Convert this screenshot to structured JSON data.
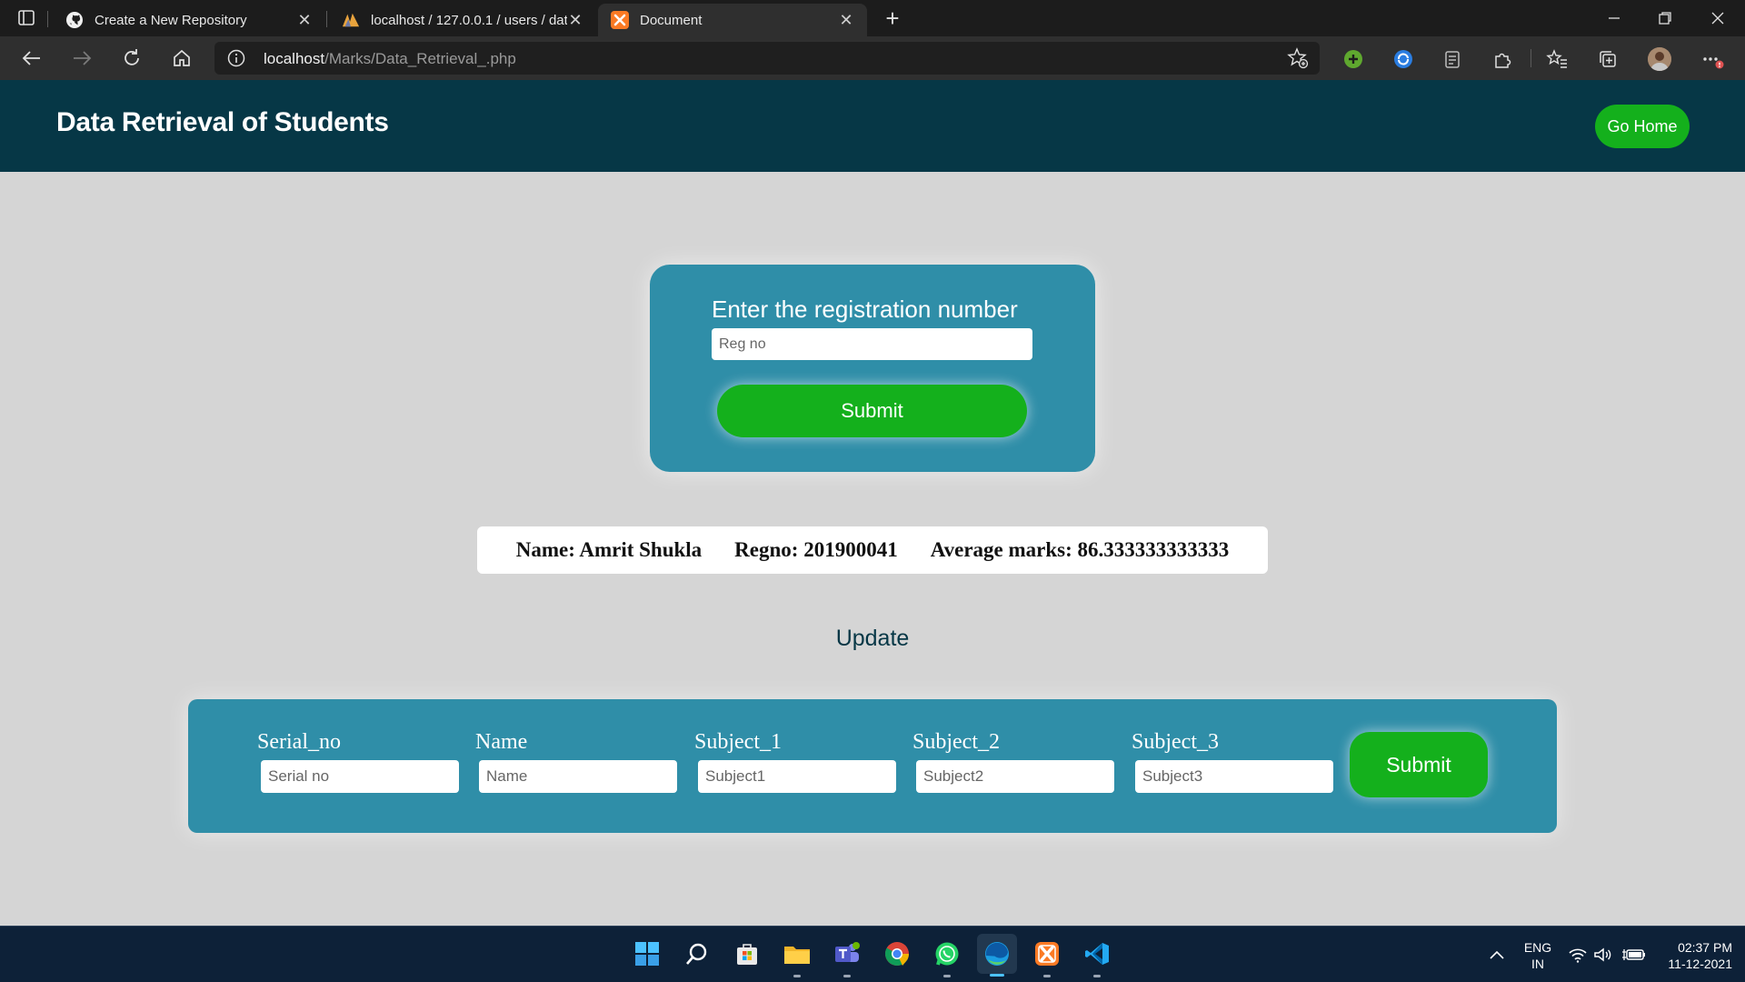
{
  "browser": {
    "tabs": [
      {
        "title": "Create a New Repository",
        "icon": "github-icon",
        "active": false
      },
      {
        "title": "localhost / 127.0.0.1 / users / dat",
        "icon": "phpmyadmin-icon",
        "active": false
      },
      {
        "title": "Document",
        "icon": "xampp-icon",
        "active": true
      }
    ],
    "url_host": "localhost",
    "url_path": "/Marks/Data_Retrieval_.php"
  },
  "page": {
    "site_title": "Data Retrieval of Students",
    "go_home_label": "Go Home",
    "registration": {
      "label": "Enter the registration number",
      "placeholder": "Reg no",
      "submit_label": "Submit"
    },
    "result": {
      "name": "Name: Amrit Shukla",
      "regno": "Regno: 201900041",
      "average": "Average marks: 86.333333333333"
    },
    "update": {
      "heading": "Update",
      "fields": [
        {
          "label": "Serial_no",
          "placeholder": "Serial no"
        },
        {
          "label": "Name",
          "placeholder": "Name"
        },
        {
          "label": "Subject_1",
          "placeholder": "Subject1"
        },
        {
          "label": "Subject_2",
          "placeholder": "Subject2"
        },
        {
          "label": "Subject_3",
          "placeholder": "Subject3"
        }
      ],
      "submit_label": "Submit"
    }
  },
  "colors": {
    "header_bg": "#063746",
    "card_bg": "#2f8ea8",
    "button_green": "#14b01c",
    "page_bg": "#d5d5d5"
  },
  "taskbar": {
    "apps": [
      "windows-start-icon",
      "search-icon",
      "microsoft-store-icon",
      "file-explorer-icon",
      "teams-icon",
      "chrome-icon",
      "whatsapp-icon",
      "edge-icon",
      "xampp-icon",
      "vscode-icon"
    ],
    "language_line1": "ENG",
    "language_line2": "IN",
    "time": "02:37 PM",
    "date": "11-12-2021"
  }
}
